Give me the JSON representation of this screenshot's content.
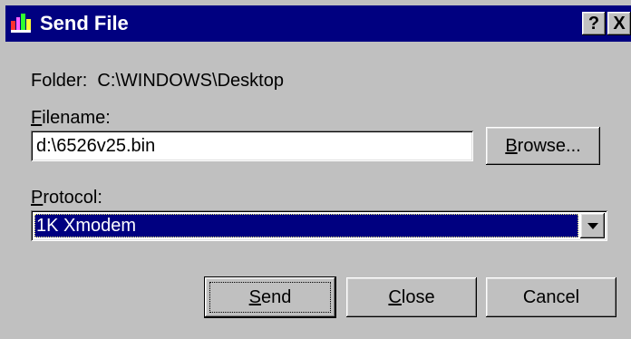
{
  "window": {
    "title": "Send File",
    "help_label": "?",
    "close_label": "X",
    "icon": "app-logo-icon"
  },
  "folder": {
    "prefix": "Folder:",
    "path": "C:\\WINDOWS\\Desktop"
  },
  "filename": {
    "label_mnemonic": "F",
    "label_rest": "ilename:",
    "value": "d:\\6526v25.bin"
  },
  "browse_button": {
    "mnemonic": "B",
    "rest": "rowse..."
  },
  "protocol": {
    "label_mnemonic": "P",
    "label_rest": "rotocol:",
    "selected": "1K Xmodem",
    "dropdown_icon": "chevron-down-icon"
  },
  "buttons": {
    "send": {
      "mnemonic": "S",
      "rest": "end"
    },
    "close": {
      "mnemonic": "C",
      "rest": "lose"
    },
    "cancel": {
      "label": "Cancel"
    }
  },
  "colors": {
    "titlebar": "#000080",
    "face": "#c0c0c0",
    "selection": "#000080"
  }
}
